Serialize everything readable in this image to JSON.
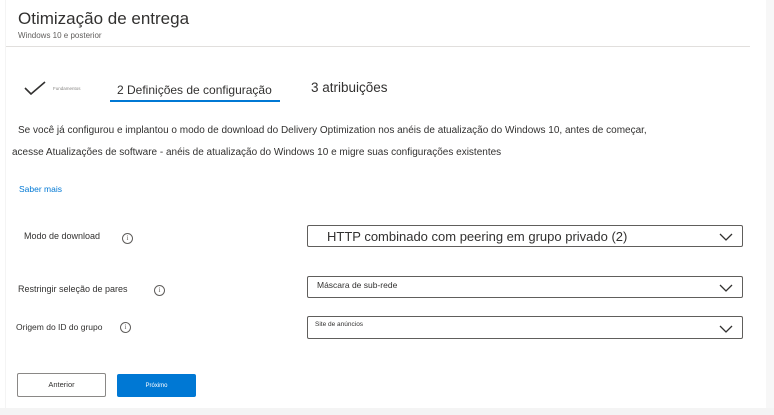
{
  "header": {
    "title": "Otimização de entrega",
    "subtitle": "Windows 10 e posterior"
  },
  "wizard": {
    "steps": [
      {
        "label": "Fundamentos",
        "state": "completed",
        "icon": "checkmark-icon"
      },
      {
        "label": "2 Definições de configuração",
        "state": "active"
      },
      {
        "label": "3 atribuições",
        "state": "upcoming"
      }
    ]
  },
  "description": {
    "line1": "Se você já configurou e implantou o modo de download do Delivery Optimization nos anéis de atualização do Windows 10, antes de começar,",
    "line2": "acesse Atualizações de software - anéis de atualização do Windows 10 e migre suas configurações existentes",
    "learn_more": "Saber mais"
  },
  "fields": [
    {
      "label": "Modo de download",
      "info_icon": "info-icon",
      "value": "HTTP combinado com peering em grupo privado (2)"
    },
    {
      "label": "Restringir seleção de pares",
      "info_icon": "info-icon",
      "value": "Máscara de sub-rede"
    },
    {
      "label": "Origem do ID do grupo",
      "info_icon": "info-icon",
      "value": "Site de anúncios"
    }
  ],
  "buttons": {
    "previous": "Anterior",
    "next": "Próximo"
  },
  "colors": {
    "accent": "#0078d4",
    "text": "#323130",
    "border": "#605e5c"
  }
}
